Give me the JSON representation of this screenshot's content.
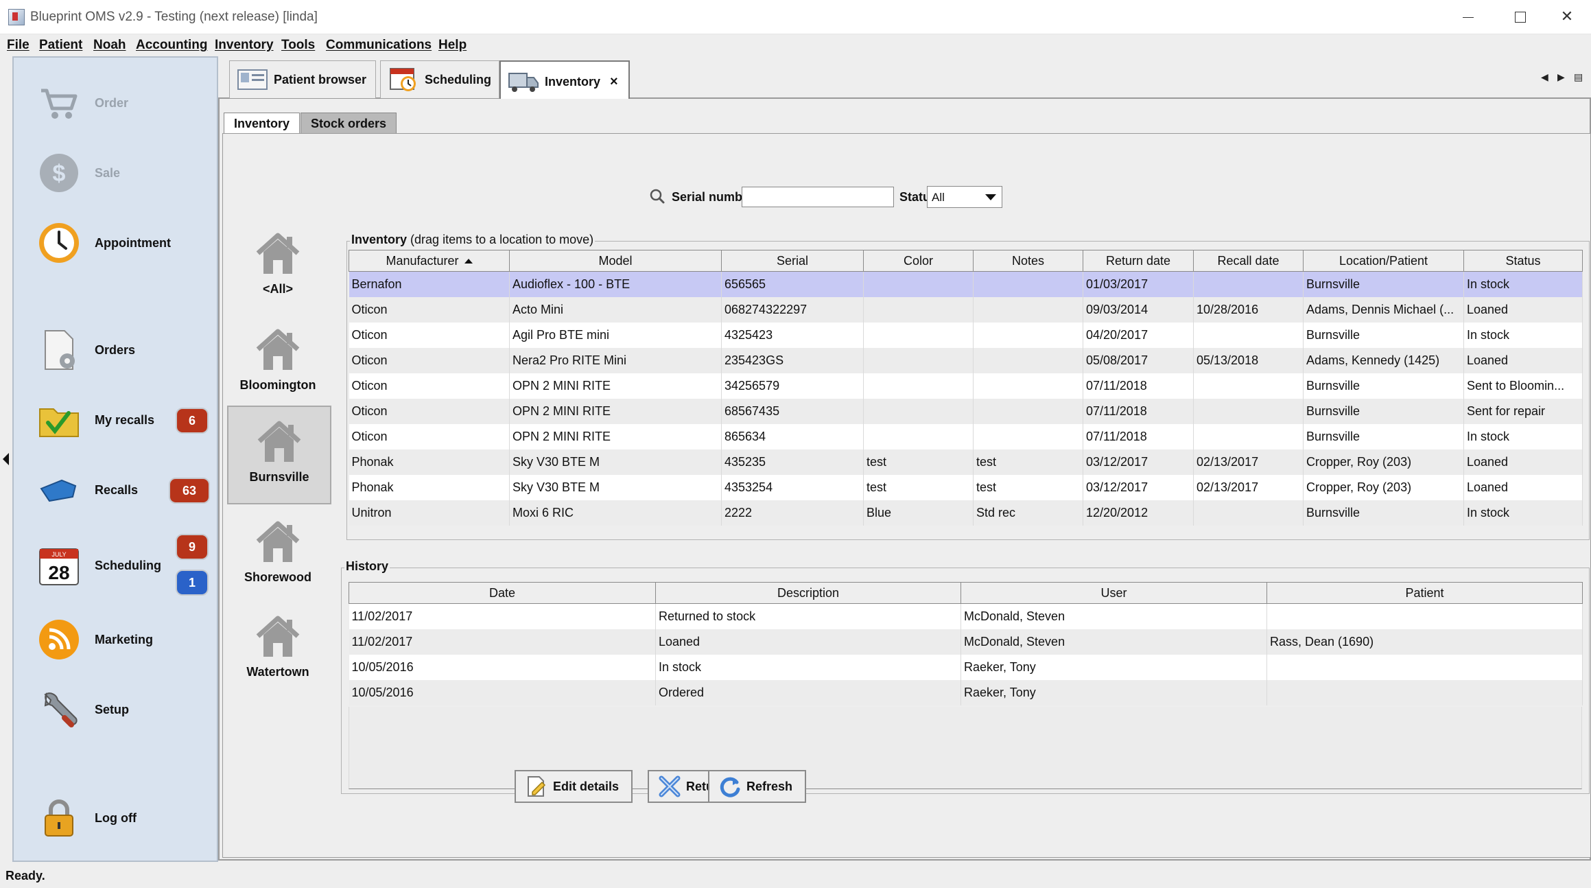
{
  "window": {
    "title": "Blueprint OMS v2.9 - Testing (next release) [linda]"
  },
  "menu": [
    "File",
    "Patient",
    "Noah",
    "Accounting",
    "Inventory",
    "Tools",
    "Communications",
    "Help"
  ],
  "nav": {
    "order": "Order",
    "sale": "Sale",
    "appointment": "Appointment",
    "orders": "Orders",
    "my_recalls": "My recalls",
    "my_recalls_badge": "6",
    "recalls": "Recalls",
    "recalls_badge": "63",
    "scheduling": "Scheduling",
    "scheduling_badge_red": "9",
    "scheduling_badge_blue": "1",
    "calendar_day": "28",
    "calendar_month": "JULY",
    "marketing": "Marketing",
    "setup": "Setup",
    "log_off": "Log off"
  },
  "tabs": {
    "patient_browser": "Patient browser",
    "scheduling": "Scheduling",
    "inventory": "Inventory",
    "close": "×"
  },
  "subtabs": {
    "inventory": "Inventory",
    "stock_orders": "Stock orders"
  },
  "search": {
    "serial_label": "Serial number: *",
    "serial_value": "",
    "status_label": "Status",
    "status_value": "All"
  },
  "locations": [
    "<All>",
    "Bloomington",
    "Burnsville",
    "Shorewood",
    "Watertown"
  ],
  "inventory": {
    "title": "Inventory",
    "subtitle": "(drag items to a location to move)",
    "columns": [
      "Manufacturer",
      "Model",
      "Serial",
      "Color",
      "Notes",
      "Return date",
      "Recall date",
      "Location/Patient",
      "Status"
    ],
    "rows": [
      [
        "Bernafon",
        "Audioflex - 100 - BTE",
        "656565",
        "",
        "",
        "01/03/2017",
        "",
        "Burnsville",
        "In stock"
      ],
      [
        "Oticon",
        "Acto Mini",
        "068274322297",
        "",
        "",
        "09/03/2014",
        "10/28/2016",
        "Adams, Dennis Michael (...",
        "Loaned"
      ],
      [
        "Oticon",
        "Agil Pro BTE mini",
        "4325423",
        "",
        "",
        "04/20/2017",
        "",
        "Burnsville",
        "In stock"
      ],
      [
        "Oticon",
        "Nera2 Pro RITE Mini",
        "235423GS",
        "",
        "",
        "05/08/2017",
        "05/13/2018",
        "Adams, Kennedy (1425)",
        "Loaned"
      ],
      [
        "Oticon",
        "OPN 2 MINI RITE",
        "34256579",
        "",
        "",
        "07/11/2018",
        "",
        "Burnsville",
        "Sent to Bloomin..."
      ],
      [
        "Oticon",
        "OPN 2 MINI RITE",
        "68567435",
        "",
        "",
        "07/11/2018",
        "",
        "Burnsville",
        "Sent for repair"
      ],
      [
        "Oticon",
        "OPN 2 MINI RITE",
        "865634",
        "",
        "",
        "07/11/2018",
        "",
        "Burnsville",
        "In stock"
      ],
      [
        "Phonak",
        "Sky V30 BTE M",
        "435235",
        "test",
        "test",
        "03/12/2017",
        "02/13/2017",
        "Cropper, Roy (203)",
        "Loaned"
      ],
      [
        "Phonak",
        "Sky V30 BTE M",
        "4353254",
        "test",
        "test",
        "03/12/2017",
        "02/13/2017",
        "Cropper, Roy (203)",
        "Loaned"
      ],
      [
        "Unitron",
        "Moxi 6 RIC",
        "2222",
        "Blue",
        "Std rec",
        "12/20/2012",
        "",
        "Burnsville",
        "In stock"
      ]
    ]
  },
  "history": {
    "title": "History",
    "columns": [
      "Date",
      "Description",
      "User",
      "Patient"
    ],
    "rows": [
      [
        "11/02/2017",
        "Returned to stock",
        "McDonald, Steven",
        ""
      ],
      [
        "11/02/2017",
        "Loaned",
        "McDonald, Steven",
        "Rass, Dean (1690)"
      ],
      [
        "10/05/2016",
        "In stock",
        "Raeker, Tony",
        ""
      ],
      [
        "10/05/2016",
        "Ordered",
        "Raeker, Tony",
        ""
      ]
    ]
  },
  "buttons": {
    "edit": "Edit details",
    "return": "Return item(s)",
    "refresh": "Refresh"
  },
  "status_bar": "Ready.",
  "colors": {
    "nav_bg": "#d9e3ef",
    "selected_row": "#c7c9f4",
    "badge_red": "#b7341a",
    "badge_blue": "#2a62c9"
  }
}
